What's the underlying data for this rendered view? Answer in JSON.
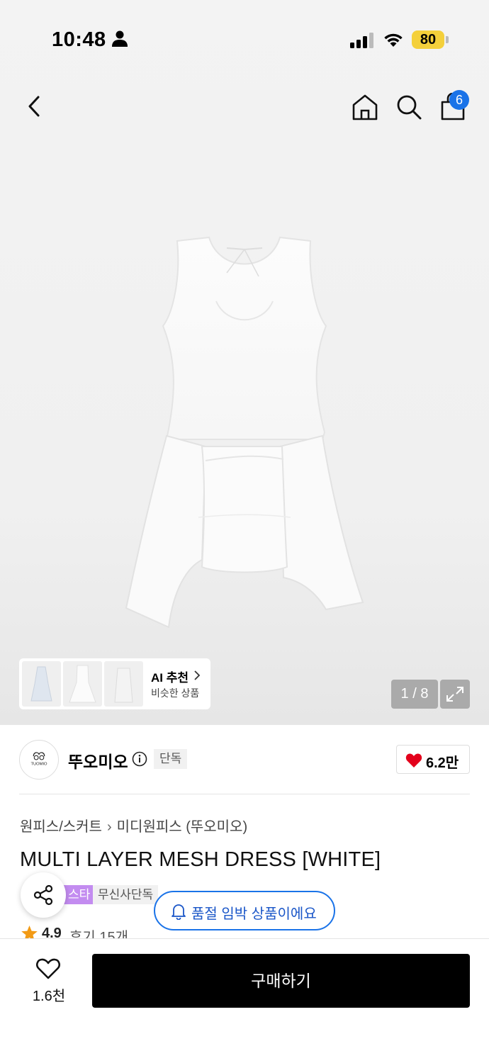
{
  "status_bar": {
    "time": "10:48",
    "battery": "80"
  },
  "nav": {
    "cart_count": "6"
  },
  "gallery": {
    "counter": "1 / 8",
    "ai": {
      "title": "AI 추천",
      "subtitle": "비슷한 상품"
    }
  },
  "brand": {
    "name": "뚜오미오",
    "logo_text": "TUOMIO",
    "tag": "단독",
    "likes": "6.2만"
  },
  "product": {
    "breadcrumb": [
      "원피스/스커트",
      "미디원피스 (뚜오미오)"
    ],
    "title": "MULTI LAYER MESH DRESS [WHITE]",
    "tags": [
      "스타",
      "무신사단독"
    ],
    "sold_out_notice": "품절 임박 상품이에요",
    "rating": "4.9",
    "reviews": "후기 15개"
  },
  "bottom_bar": {
    "wish_count": "1.6천",
    "buy_label": "구매하기"
  },
  "colors": {
    "accent": "#1a73e8",
    "heart": "#e3001b",
    "tag_purple": "#c38cf0",
    "battery": "#f4d03b"
  }
}
